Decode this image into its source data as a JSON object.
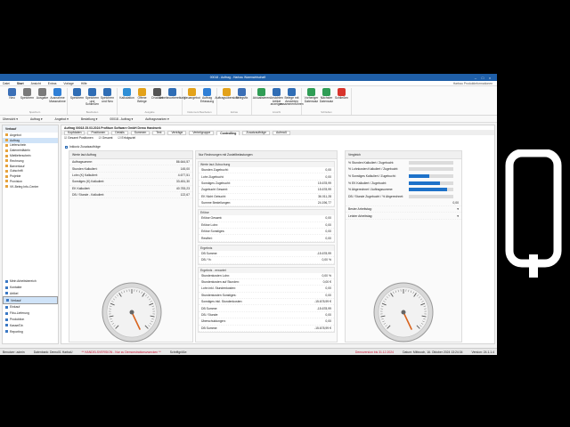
{
  "window": {
    "title": "00018 - Auftrag - Harbau Warenwirtschaft"
  },
  "menu": {
    "items": [
      "Datei",
      "Start",
      "Ansicht",
      "Extras",
      "Vorlage",
      "Hilfe"
    ],
    "active_index": 1,
    "right": "Harbau Produktinformationen"
  },
  "ribbon": {
    "groups": [
      {
        "label": "Speichern",
        "buttons": [
          {
            "label": "Neu",
            "color": "#3b6fb6"
          },
          {
            "label": "Speichern",
            "color": "#7a7a7a"
          },
          {
            "label": "Ausgabe",
            "color": "#7a7a7a"
          },
          {
            "label": "Ausnahme Massnahme",
            "color": "#2f7fd6"
          }
        ]
      },
      {
        "label": "Bearbeiten",
        "buttons": [
          {
            "label": "Speichern",
            "color": "#2f6db5"
          },
          {
            "label": "Speichern und Schließen",
            "color": "#2f6db5"
          },
          {
            "label": "Speichern und Neu",
            "color": "#2f6db5"
          }
        ]
      },
      {
        "label": "Ausgabe",
        "buttons": [
          {
            "label": "Kalkulation",
            "color": "#2f8fd6"
          },
          {
            "label": "Offene Belege",
            "color": "#e3a21a"
          },
          {
            "label": "Drucken",
            "color": "#555555"
          },
          {
            "label": "Arbeitsvorbereitung",
            "color": "#2f6db5"
          }
        ]
      },
      {
        "label": "Dokument Bearbeiten",
        "buttons": [
          {
            "label": "Neuangebot",
            "color": "#e3a21a"
          },
          {
            "label": "Auftrag Erfassung",
            "color": "#2f7fd6"
          }
        ]
      },
      {
        "label": "Extras",
        "buttons": [
          {
            "label": "Auftragsübersicht",
            "color": "#e3a21a"
          },
          {
            "label": "Belegsfix",
            "color": "#3b6fb6"
          }
        ]
      },
      {
        "label": "Ansicht",
        "buttons": [
          {
            "label": "Aktualisieren",
            "color": "#2f9d55"
          },
          {
            "label": "Ansichten Artikel anzeigen",
            "color": "#2f6db5"
          },
          {
            "label": "Belege mit Ansichten zusammenführen",
            "color": "#2f6db5"
          }
        ]
      },
      {
        "label": "Schließen",
        "buttons": [
          {
            "label": "Vorheriger Datensatz",
            "color": "#2f9d55"
          },
          {
            "label": "Nächster Datensatz",
            "color": "#2f9d55"
          },
          {
            "label": "Schließen",
            "color": "#d8342c"
          }
        ]
      }
    ]
  },
  "toolrow": [
    "Übersicht",
    "Auftrag",
    "Angebot",
    "Bestellung",
    "00018 - Auftrag",
    "Auftragsmarken"
  ],
  "nav": {
    "header": "Verkauf",
    "items": [
      {
        "label": "Angebot",
        "selected": false
      },
      {
        "label": "Auftrag",
        "selected": true
      },
      {
        "label": "Lieferschein",
        "selected": false
      },
      {
        "label": "Dateneinfädeln",
        "selected": false
      },
      {
        "label": "Mietlieferschein",
        "selected": false
      },
      {
        "label": "Rechnung",
        "selected": false
      },
      {
        "label": "Barverkauf",
        "selected": false
      },
      {
        "label": "Gutschrift",
        "selected": false
      },
      {
        "label": "Projekte",
        "selected": false
      },
      {
        "label": "Provision",
        "selected": false
      },
      {
        "label": "VK-Beleg Info-Center",
        "selected": false
      }
    ],
    "modules": [
      {
        "label": "Mein Arbeitsbereich",
        "selected": false
      },
      {
        "label": "Kontakte",
        "selected": false
      },
      {
        "label": "Artikel",
        "selected": false
      },
      {
        "label": "Verkauf",
        "selected": true
      },
      {
        "label": "Einkauf",
        "selected": false
      },
      {
        "label": "Fibu-Lieferung",
        "selected": false
      },
      {
        "label": "Produktion",
        "selected": false
      },
      {
        "label": "Kasse/Dir.",
        "selected": false
      },
      {
        "label": "Reporting",
        "selected": false
      }
    ]
  },
  "doc": {
    "title": "Auftrag 00018 25.03.2024 Profitum Software GmbH Demo Handwerk"
  },
  "tabs": [
    "Kopfdaten",
    "Positionen",
    "Details",
    "Summen",
    "Text",
    "Verträge",
    "Verteilgruppe",
    "Controlling",
    "Zusatzaufträge",
    "Aufmaß"
  ],
  "active_tab": "Controlling",
  "subtabs": [
    "Gesamt Positionen",
    "Gesamt",
    "Erfolgsziel"
  ],
  "check_label": "Inklusiv Zusatzaufträge",
  "left_panel": {
    "header": "Werte laut Auftrag",
    "rows": [
      {
        "label": "Auftragsumme:",
        "value": "86.644,57"
      },
      {
        "label": "Stunden Kalkuliert:",
        "value": "145,00"
      },
      {
        "label": "Lohn (K) Kalkuliert:",
        "value": "4.677,51"
      },
      {
        "label": "Sonstiges (K) Kalkuliert:",
        "value": "33.451,30"
      },
      {
        "label": "EK Kalkuliert:",
        "value": "40.783,23"
      },
      {
        "label": "DB / Stunde - Kalkuliert:",
        "value": "122,67"
      }
    ]
  },
  "mid_panel": {
    "header": "Nur Rechnungen mit Zustellbelastungen",
    "sections": [
      {
        "title": "Werte laut Zubuchung",
        "rows": [
          {
            "label": "Stunden Zugebucht:",
            "value": "0,00"
          },
          {
            "label": "Lohn Zugebucht:",
            "value": "0,00"
          },
          {
            "label": "Sonstiges Zugebucht:",
            "value": "15.678,99"
          },
          {
            "label": "Zugebucht Gesamt:",
            "value": "15.678,99"
          },
          {
            "label": "EK Nicht Gebucht:",
            "value": "36.011,28"
          },
          {
            "label": "Summe Bestellungen:",
            "value": "24.196,77"
          }
        ]
      },
      {
        "title": "Erlöse",
        "rows": [
          {
            "label": "Erlöse Gesamt:",
            "value": "0,00"
          },
          {
            "label": "Erlöse Lohn:",
            "value": "0,00"
          },
          {
            "label": "Erlöse Sonstiges:",
            "value": "0,00"
          },
          {
            "label": "Restfrei:",
            "value": "0,00"
          }
        ]
      },
      {
        "title": "Ergebnis",
        "rows": [
          {
            "label": "DB Summe:",
            "value": "-15.678,99"
          },
          {
            "label": "DB / %:",
            "value": "0,00 %"
          }
        ]
      },
      {
        "title": "Ergebnis - erwartet",
        "rows": [
          {
            "label": "Stundenkosten Lohn:",
            "value": "0,00 %"
          },
          {
            "label": "Stundenkosten auf Stunden:",
            "value": "0,00 €"
          },
          {
            "label": "Lohn inkl. Stundenkosten:",
            "value": "0,00"
          },
          {
            "label": "Stundenkosten Sonstiges:",
            "value": "0,00"
          },
          {
            "label": "Sonstiges inkl. Stundenkosten:",
            "value": "-15.678,99 €"
          },
          {
            "label": "DB Summe:",
            "value": "-15.678,99"
          },
          {
            "label": "DB / Stunde:",
            "value": "0,00"
          },
          {
            "label": "Überschuldungen:",
            "value": "0,00"
          },
          {
            "label": "DB Summe:",
            "value": "-15.678,99 €"
          }
        ]
      }
    ]
  },
  "right_panel": {
    "header": "Vergleich",
    "bars": [
      {
        "label": "% Stunden Kalkuliert / Zugebucht:",
        "fill": 0
      },
      {
        "label": "% Lohnkosten Kalkuliert / Zugebucht:",
        "fill": 0
      },
      {
        "label": "% Sonstiges Kalkuliert / Zugebucht:",
        "fill": 0.45
      },
      {
        "label": "% EK Kalkuliert / Zugebucht:",
        "fill": 0.7
      },
      {
        "label": "% Abgerechnet / Auftragssumme:",
        "fill": 0.85
      },
      {
        "label": "DB / Stunde Zugebucht / % Abgerechnet:",
        "fill": 0
      }
    ],
    "db_value": "0,00",
    "extra": [
      {
        "label": "Bester Arbeitstag:",
        "value": ""
      },
      {
        "label": "Letzter Arbeitstag:",
        "value": ""
      }
    ]
  },
  "status": {
    "user": "Benutzer: admin",
    "db": "Datenbank: Demo01 HarbaU",
    "warning": "** HANDELSVERSION - Nur zu Demonstrationszwecken **",
    "mode": "Schriftgröße:",
    "right1": "Demoversion bis 31.12.2024",
    "right2": "Datum: Mittwoch, 16. Oktober 2024 13:24:34",
    "right3": "Version: 24.1.1.4"
  },
  "colors": {
    "titlebar": "#1f5fa8",
    "bar_fill": "#1e72c9",
    "needle": "#d9641e"
  }
}
